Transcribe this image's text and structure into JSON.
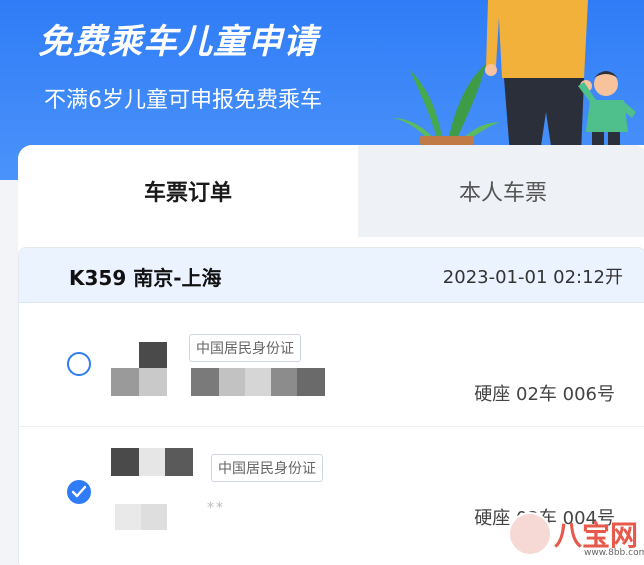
{
  "header": {
    "title": "免费乘车儿童申请",
    "subtitle": "不满6岁儿童可申报免费乘车"
  },
  "tabs": [
    {
      "label": "车票订单",
      "active": true
    },
    {
      "label": "本人车票",
      "active": false
    }
  ],
  "order": {
    "train": "K359 南京-上海",
    "depart": "2023-01-01 02:12开",
    "passengers": [
      {
        "selected": false,
        "id_type": "中国居民身份证",
        "seat": "硬座 02车 006号"
      },
      {
        "selected": true,
        "id_type": "中国居民身份证",
        "id_mask": "**",
        "seat": "硬座 02车 004号"
      }
    ]
  },
  "watermark": {
    "text": "八宝网",
    "url": "www.8bb.com"
  },
  "colors": {
    "primary": "#2f7cf6",
    "header_bg": "#eaf3ff",
    "watermark": "#e7594a"
  }
}
